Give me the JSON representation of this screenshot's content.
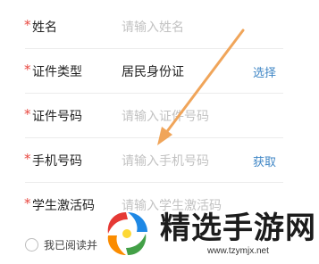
{
  "form": {
    "name": {
      "label": "姓名",
      "placeholder": "请输入姓名"
    },
    "id_type": {
      "label": "证件类型",
      "value": "居民身份证",
      "action": "选择"
    },
    "id_number": {
      "label": "证件号码",
      "placeholder": "请输入证件号码"
    },
    "phone": {
      "label": "手机号码",
      "placeholder": "请输入手机号码",
      "action": "获取"
    },
    "activation": {
      "label": "学生激活码",
      "placeholder": "请输入学生激活码"
    },
    "required_mark": "*"
  },
  "consent": {
    "text": "我已阅读并"
  },
  "watermark": {
    "title": "精选手游网",
    "url": "www.tzymjx.net"
  },
  "colors": {
    "required": "#e8473f",
    "action": "#3f86c5",
    "placeholder": "#c2c2c2",
    "arrow": "#f0a55a"
  }
}
